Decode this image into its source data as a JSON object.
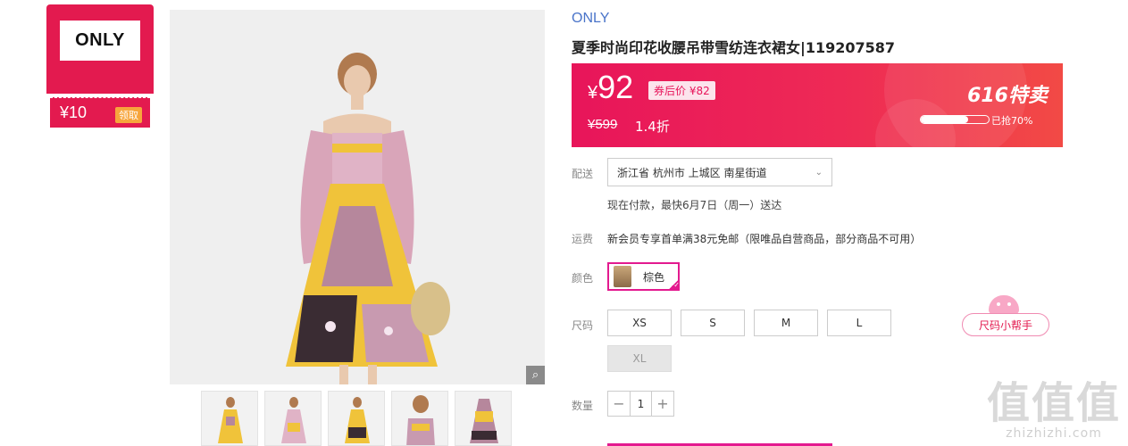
{
  "badge": {
    "logo": "ONLY",
    "amount": "¥10",
    "claim": "领取"
  },
  "product": {
    "brand": "ONLY",
    "title": "夏季时尚印花收腰吊带雪纺连衣裙女|119207587",
    "thumbnails_count": 5
  },
  "price": {
    "yen": "¥",
    "current": "92",
    "after_coupon": "券后价 ¥82",
    "original": "¥599",
    "discount": "1.4折",
    "sale_title": "616特卖",
    "sold_fraction": 0.7,
    "sold_text": "已抢70%"
  },
  "delivery": {
    "label": "配送",
    "address": "浙江省 杭州市 上城区 南星街道",
    "note": "现在付款，最快6月7日（周一）送达"
  },
  "shipping": {
    "label": "运费",
    "text": "新会员专享首单满38元免邮（限唯品自营商品，部分商品不可用）"
  },
  "color": {
    "label": "颜色",
    "selected": "棕色"
  },
  "size": {
    "label": "尺码",
    "options": [
      "XS",
      "S",
      "M",
      "L",
      "XL"
    ],
    "disabled": [
      "XL"
    ],
    "helper": "尺码小帮手"
  },
  "quantity": {
    "label": "数量",
    "value": "1",
    "minus": "−",
    "plus": "+"
  },
  "watermark": {
    "main": "值值值",
    "sub": "zhizhizhi.com"
  },
  "colors": {
    "accent": "#e31a4f",
    "brand_blue": "#4a74c9",
    "selected_border": "#e31a8f"
  }
}
